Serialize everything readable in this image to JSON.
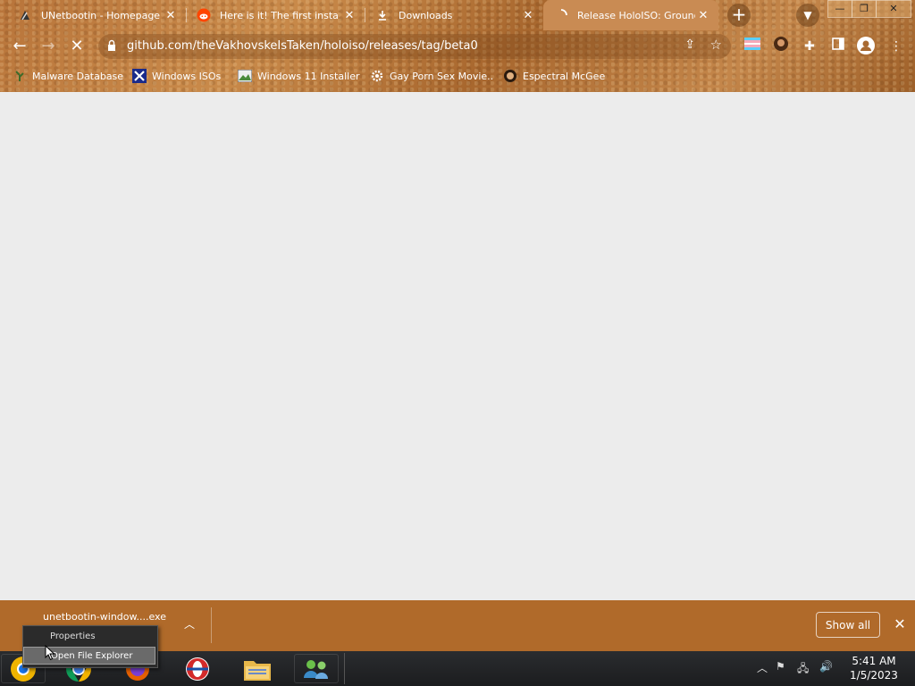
{
  "tabs": [
    {
      "title": "UNetbootin - Homepage a",
      "icon": "unetbootin-icon"
    },
    {
      "title": "Here is it! The first insta",
      "icon": "reddit-icon"
    },
    {
      "title": "Downloads",
      "icon": "download-icon"
    },
    {
      "title": "Release HoloISO: Ground",
      "icon": "github-loading-icon"
    }
  ],
  "window_controls": {
    "minimize": "—",
    "maximize": "❐",
    "close": "✕"
  },
  "toolbar": {
    "url": "github.com/theVakhovskeIsTaken/holoiso/releases/tag/beta0"
  },
  "bookmarks": [
    {
      "label": "Malware Database",
      "icon": "plant-icon"
    },
    {
      "label": "Windows ISOs",
      "icon": "x-logo-icon"
    },
    {
      "label": "Windows 11 Installer",
      "icon": "image-icon"
    },
    {
      "label": "Gay Porn Sex Movie..",
      "icon": "gear-icon"
    },
    {
      "label": "Espectral McGee",
      "icon": "avatar-icon"
    }
  ],
  "download_bar": {
    "file_name": "unetbootin-window....exe",
    "show_all": "Show all"
  },
  "context_menu": {
    "items": [
      "Properties",
      "Open File Explorer"
    ]
  },
  "taskbar": {
    "time": "5:41 AM",
    "date": "1/5/2023"
  },
  "colors": {
    "theme_brown": "#b06a2a",
    "content_bg": "#ececec",
    "taskbar": "#1c1d1f"
  }
}
